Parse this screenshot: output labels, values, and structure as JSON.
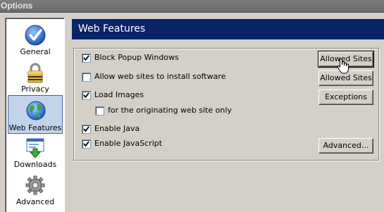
{
  "window": {
    "title": "Options"
  },
  "sidebar": {
    "items": [
      {
        "label": "General",
        "icon": "checkmark-icon",
        "selected": false
      },
      {
        "label": "Privacy",
        "icon": "lock-icon",
        "selected": false
      },
      {
        "label": "Web Features",
        "icon": "globe-icon",
        "selected": true
      },
      {
        "label": "Downloads",
        "icon": "download-icon",
        "selected": false
      },
      {
        "label": "Advanced",
        "icon": "gear-icon",
        "selected": false
      }
    ]
  },
  "panel": {
    "title": "Web Features",
    "options": [
      {
        "label": "Block Popup Windows",
        "checked": true
      },
      {
        "label": "Allow web sites to install software",
        "checked": false
      },
      {
        "label": "Load Images",
        "checked": true
      },
      {
        "label": "for the originating web site only",
        "checked": false
      },
      {
        "label": "Enable Java",
        "checked": true
      },
      {
        "label": "Enable JavaScript",
        "checked": true
      }
    ],
    "buttons": {
      "allowed_sites_popup": "Allowed Sites",
      "allowed_sites_install": "Allowed Sites",
      "exceptions": "Exceptions",
      "advanced": "Advanced..."
    }
  },
  "colors": {
    "header_bg": "#0a246a",
    "selected_nav_bg": "#c3d3ea",
    "window_bg": "#d4d0c8"
  }
}
